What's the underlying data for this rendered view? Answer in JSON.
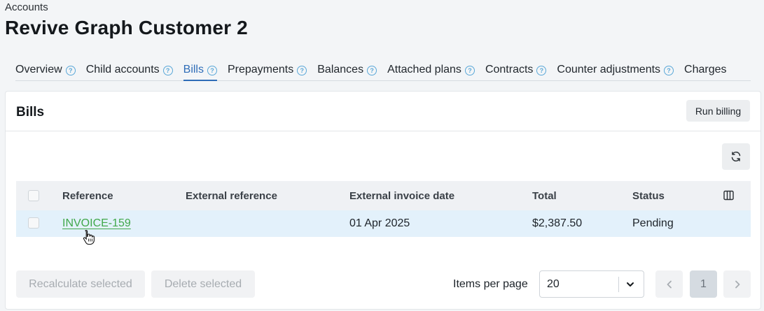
{
  "breadcrumb": "Accounts",
  "page_title": "Revive Graph Customer 2",
  "tabs": [
    {
      "label": "Overview",
      "help": true
    },
    {
      "label": "Child accounts",
      "help": true
    },
    {
      "label": "Bills",
      "help": true,
      "active": true
    },
    {
      "label": "Prepayments",
      "help": true
    },
    {
      "label": "Balances",
      "help": true
    },
    {
      "label": "Attached plans",
      "help": true
    },
    {
      "label": "Contracts",
      "help": true
    },
    {
      "label": "Counter adjustments",
      "help": true
    },
    {
      "label": "Charges",
      "help": false
    }
  ],
  "help_glyph": "?",
  "card": {
    "title": "Bills",
    "run_billing_label": "Run billing"
  },
  "table": {
    "headers": {
      "reference": "Reference",
      "external_reference": "External reference",
      "external_invoice_date": "External invoice date",
      "total": "Total",
      "status": "Status"
    },
    "rows": [
      {
        "reference": "INVOICE-159",
        "external_reference": "",
        "external_invoice_date": "01 Apr 2025",
        "total": "$2,387.50",
        "status": "Pending"
      }
    ]
  },
  "footer": {
    "recalculate_label": "Recalculate selected",
    "delete_label": "Delete selected",
    "items_per_page_label": "Items per page",
    "items_per_page_value": "20",
    "current_page": "1"
  },
  "colors": {
    "accent": "#2f6db8",
    "link": "#41a84a",
    "row_highlight": "#e3f1fb",
    "help_icon": "#5aa8d8"
  },
  "icons": [
    "help-icon",
    "refresh-icon",
    "columns-icon",
    "chevron-down-icon",
    "chevron-left-icon",
    "chevron-right-icon",
    "hand-cursor-icon"
  ]
}
